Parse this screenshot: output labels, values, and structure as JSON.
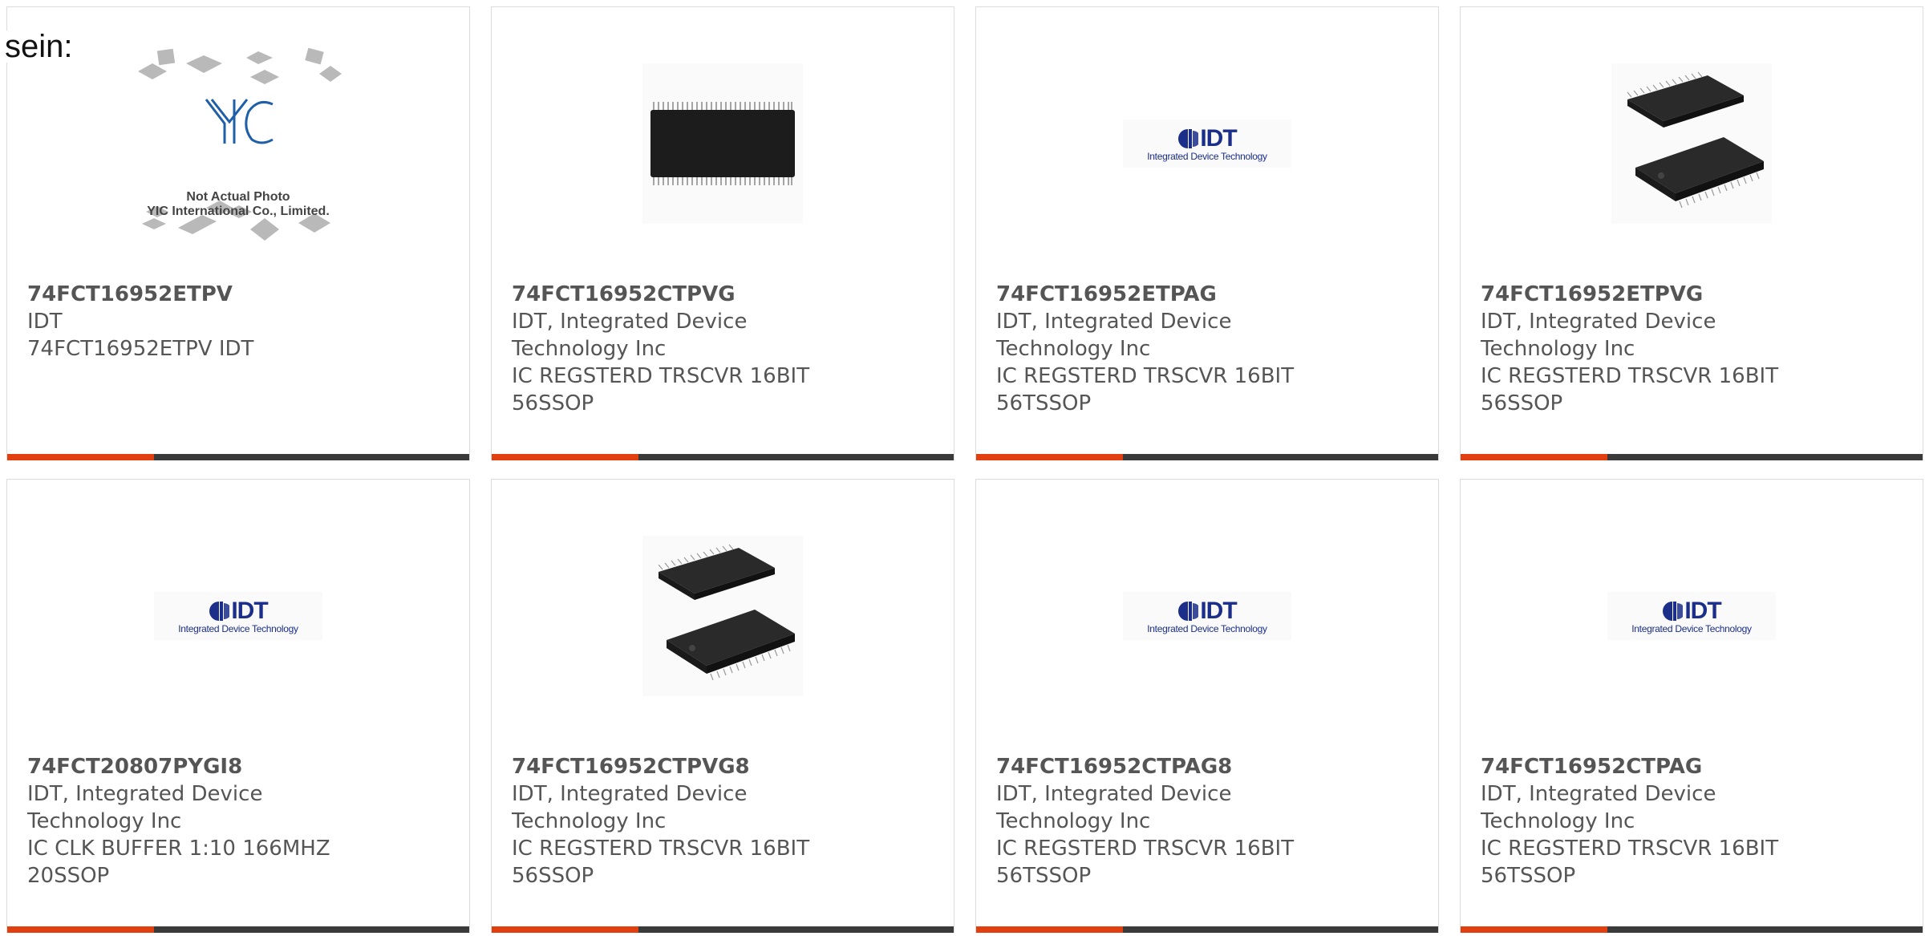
{
  "intro_text": "sein:",
  "brand": {
    "idt_wordmark": "IDT",
    "idt_tagline": "Integrated Device Technology",
    "placeholder_caption_1": "Not Actual Photo",
    "placeholder_caption_2": "YIC International Co., Limited.",
    "placeholder_logo": "YIC"
  },
  "colors": {
    "accent": "#e23f10",
    "bar": "#3a3a3a",
    "idt_blue": "#1a2e8a"
  },
  "products": [
    {
      "part": "74FCT16952ETPV",
      "maker": "IDT",
      "desc": "74FCT16952ETPV IDT",
      "image": "placeholder-photo"
    },
    {
      "part": "74FCT16952CTPVG",
      "maker": "IDT, Integrated Device Technology Inc",
      "desc": "IC REGSTERD TRSCVR 16BIT 56SSOP",
      "image": "chip-top-view"
    },
    {
      "part": "74FCT16952ETPAG",
      "maker": "IDT, Integrated Device Technology Inc",
      "desc": "IC REGSTERD TRSCVR 16BIT 56TSSOP",
      "image": "idt-logo"
    },
    {
      "part": "74FCT16952ETPVG",
      "maker": "IDT, Integrated Device Technology Inc",
      "desc": "IC REGSTERD TRSCVR 16BIT 56SSOP",
      "image": "chip-isometric"
    },
    {
      "part": "74FCT20807PYGI8",
      "maker": "IDT, Integrated Device Technology Inc",
      "desc": "IC CLK BUFFER 1:10 166MHZ 20SSOP",
      "image": "idt-logo"
    },
    {
      "part": "74FCT16952CTPVG8",
      "maker": "IDT, Integrated Device Technology Inc",
      "desc": "IC REGSTERD TRSCVR 16BIT 56SSOP",
      "image": "chip-isometric"
    },
    {
      "part": "74FCT16952CTPAG8",
      "maker": "IDT, Integrated Device Technology Inc",
      "desc": "IC REGSTERD TRSCVR 16BIT 56TSSOP",
      "image": "idt-logo"
    },
    {
      "part": "74FCT16952CTPAG",
      "maker": "IDT, Integrated Device Technology Inc",
      "desc": "IC REGSTERD TRSCVR 16BIT 56TSSOP",
      "image": "idt-logo"
    }
  ]
}
